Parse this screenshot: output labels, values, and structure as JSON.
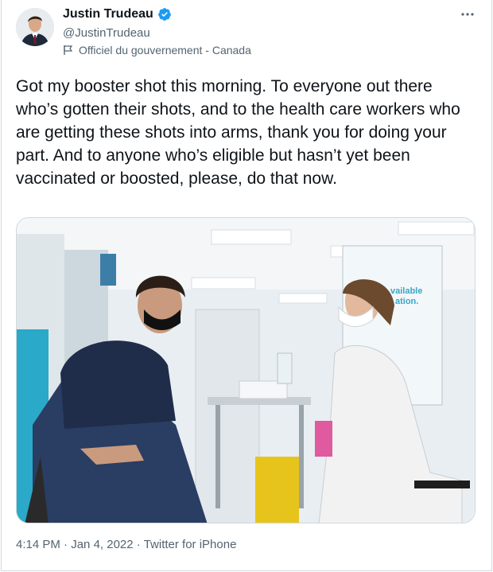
{
  "author": {
    "name": "Justin Trudeau",
    "handle": "@JustinTrudeau",
    "affiliation": "Officiel du gouvernement - Canada",
    "verified": true
  },
  "tweet": {
    "text": "Got my booster shot this morning. To everyone out there who’s gotten their shots, and to the health care workers who are getting these shots into arms, thank you for doing your part. And to anyone who’s eligible but hasn’t yet been vaccinated or boosted, please, do that now."
  },
  "photo": {
    "poster_text_1": "vailable",
    "poster_text_2": "ation."
  },
  "meta": {
    "time": "4:14 PM",
    "date": "Jan 4, 2022",
    "source": "Twitter for iPhone"
  },
  "colors": {
    "verified_blue": "#1d9bf0",
    "secondary_text": "#536471",
    "primary_text": "#0f1419"
  },
  "icons": {
    "verified": "verified-badge-icon",
    "government_flag": "flag-icon",
    "more": "more-dots-icon"
  }
}
